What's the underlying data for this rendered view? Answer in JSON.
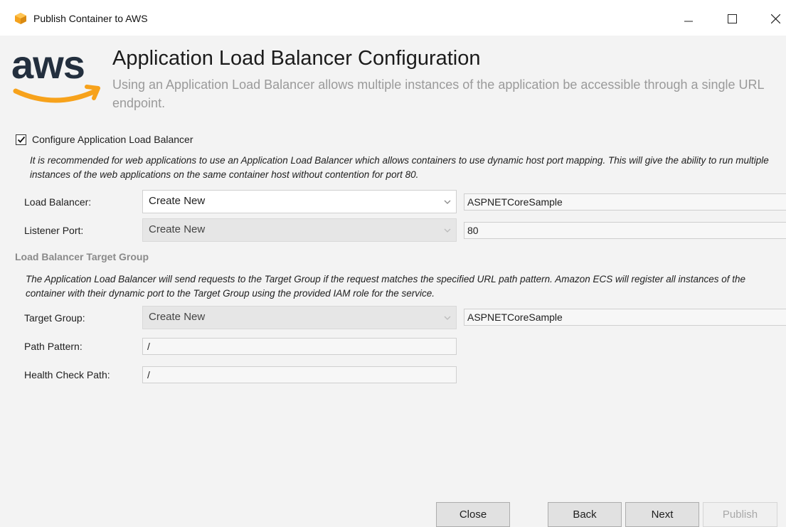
{
  "window": {
    "title": "Publish Container to AWS",
    "minimize_icon": "minimize-icon",
    "maximize_icon": "maximize-icon",
    "close_icon": "close-icon"
  },
  "header": {
    "logo_text": "aws",
    "title": "Application Load Balancer Configuration",
    "description": "Using an Application Load Balancer allows multiple instances of the application be accessible through a single URL endpoint."
  },
  "configure": {
    "checked": true,
    "label": "Configure Application Load Balancer",
    "note": "It is recommended for web applications to use an Application Load Balancer which allows containers to use dynamic host port mapping. This will give the ability to run multiple instances of the web applications on the same container host without contention for port 80."
  },
  "load_balancer": {
    "label": "Load Balancer:",
    "selected": "Create New",
    "name": "ASPNETCoreSample"
  },
  "listener_port": {
    "label": "Listener Port:",
    "selected": "Create New",
    "value": "80"
  },
  "target_group_section": {
    "header": "Load Balancer Target Group",
    "note": "The Application Load Balancer will send requests to the Target Group if the request matches the specified URL path pattern. Amazon ECS will register all instances of the container with their dynamic port to the Target Group using the provided IAM role for the service."
  },
  "target_group": {
    "label": "Target Group:",
    "selected": "Create New",
    "name": "ASPNETCoreSample"
  },
  "path_pattern": {
    "label": "Path Pattern:",
    "value": "/"
  },
  "health_check": {
    "label": "Health Check Path:",
    "value": "/"
  },
  "buttons": {
    "close": "Close",
    "back": "Back",
    "next": "Next",
    "publish": "Publish"
  },
  "colors": {
    "aws_orange": "#f7a21b",
    "aws_dark": "#232f3e",
    "description_gray": "#9a9a9a"
  }
}
